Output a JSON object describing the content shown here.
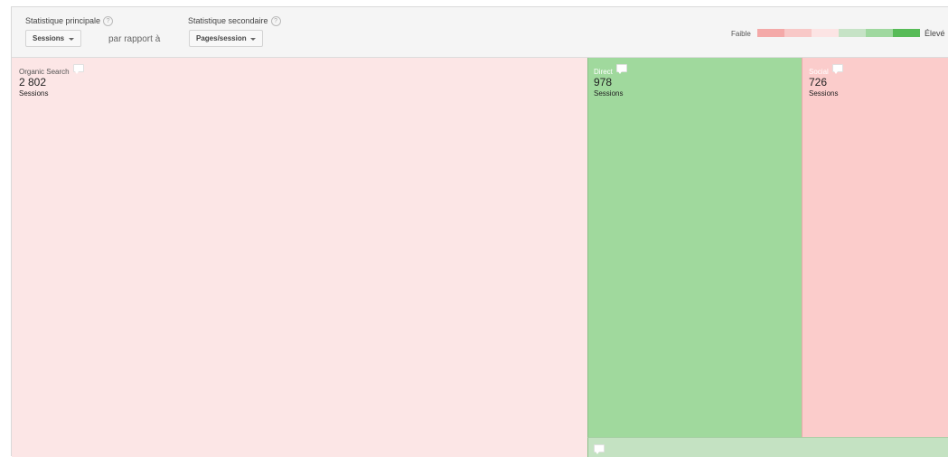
{
  "controls": {
    "primary_label": "Statistique principale",
    "primary_value": "Sessions",
    "secondary_label": "Statistique secondaire",
    "secondary_value": "Pages/session",
    "versus_label": "par rapport à",
    "help_glyph": "?"
  },
  "legend": {
    "low_label": "Faible",
    "high_label": "Élevé",
    "scale_colors": [
      "#f4a9a8",
      "#f8c8c7",
      "#fce4e4",
      "#c6e3c6",
      "#9fd89f",
      "#57bb57"
    ]
  },
  "treemap": {
    "metric_label": "Sessions",
    "tiles": [
      {
        "name": "Organic Search",
        "value": "2 802",
        "metric": "Sessions",
        "color": "#fce6e6"
      },
      {
        "name": "Direct",
        "value": "978",
        "metric": "Sessions",
        "color": "#a0d99d"
      },
      {
        "name": "Social",
        "value": "726",
        "metric": "Sessions",
        "color": "#fbcccb"
      },
      {
        "name": "",
        "value": "",
        "metric": "",
        "color": "#c4e2c2"
      }
    ]
  }
}
